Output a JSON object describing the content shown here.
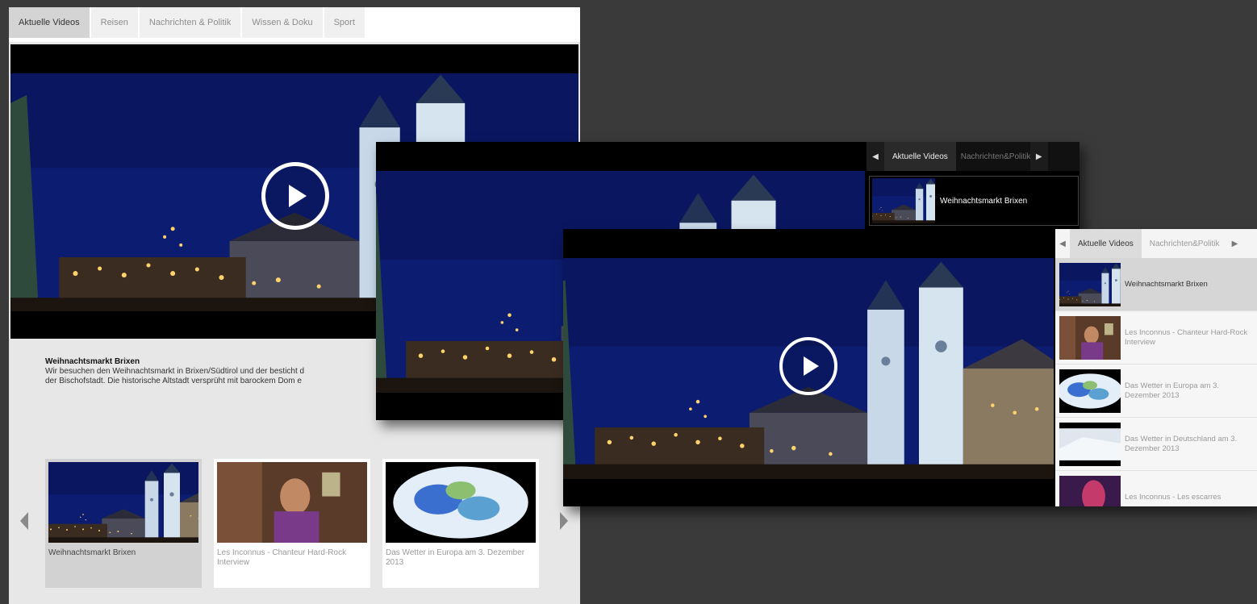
{
  "desktop": {
    "tabs": [
      "Aktuelle Videos",
      "Reisen",
      "Nachrichten & Politik",
      "Wissen & Doku",
      "Sport"
    ],
    "active_tab": 0,
    "video": {
      "title": "Weihnachtsmarkt Brixen"
    },
    "description": {
      "title": "Weihnachtsmarkt Brixen",
      "line1": "Wir besuchen den Weihnachtsmarkt in Brixen/Südtirol und der besticht d",
      "line2": "der Bischofstadt. Die historische Altstadt versprüht mit barockem Dom e"
    },
    "thumbnails": [
      {
        "label": "Weihnachtsmarkt Brixen",
        "active": true
      },
      {
        "label": "Les Inconnus - Chanteur Hard-Rock Interview",
        "active": false
      },
      {
        "label": "Das Wetter in Europa am 3. Dezember 2013",
        "active": false
      }
    ]
  },
  "tablet": {
    "tabs": [
      "Aktuelle Videos",
      "Nachrichten&Politik"
    ],
    "list": [
      {
        "label": "Weihnachtsmarkt Brixen"
      }
    ]
  },
  "wide": {
    "tabs": [
      "Aktuelle Videos",
      "Nachrichten&Politik"
    ],
    "list": [
      {
        "label": "Weihnachtsmarkt Brixen",
        "active": true
      },
      {
        "label": "Les Inconnus - Chanteur Hard-Rock Interview",
        "active": false
      },
      {
        "label": "Das Wetter in Europa am 3. Dezember 2013",
        "active": false
      },
      {
        "label": "Das Wetter in Deutschland am 3. Dezember 2013",
        "active": false
      },
      {
        "label": "Les Inconnus - Les escarres",
        "active": false
      }
    ]
  },
  "icons": {
    "play": "play-icon",
    "prev": "chevron-left-icon",
    "next": "chevron-right-icon"
  },
  "colors": {
    "background": "#3a3a3a",
    "night_sky": "#0b1b6b",
    "panel_light": "#e7e7e7"
  }
}
